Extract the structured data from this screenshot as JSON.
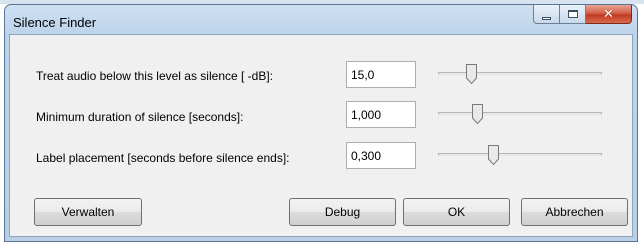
{
  "window": {
    "title": "Silence Finder"
  },
  "caption_buttons": {
    "minimize_icon": "minimize-icon",
    "maximize_icon": "maximize-icon",
    "close_icon": "close-icon"
  },
  "fields": [
    {
      "label": "Treat audio below this level as silence [ -dB]:",
      "value": "15,0",
      "slider_position": 0.18
    },
    {
      "label": "Minimum duration of silence [seconds]:",
      "value": "1,000",
      "slider_position": 0.22
    },
    {
      "label": "Label placement [seconds before silence ends]:",
      "value": "0,300",
      "slider_position": 0.33
    }
  ],
  "buttons": {
    "manage": "Verwalten",
    "debug": "Debug",
    "ok": "OK",
    "cancel": "Abbrechen"
  },
  "colors": {
    "frame": "#b8cfe6",
    "client": "#f0f0f0",
    "close": "#c13b22"
  }
}
